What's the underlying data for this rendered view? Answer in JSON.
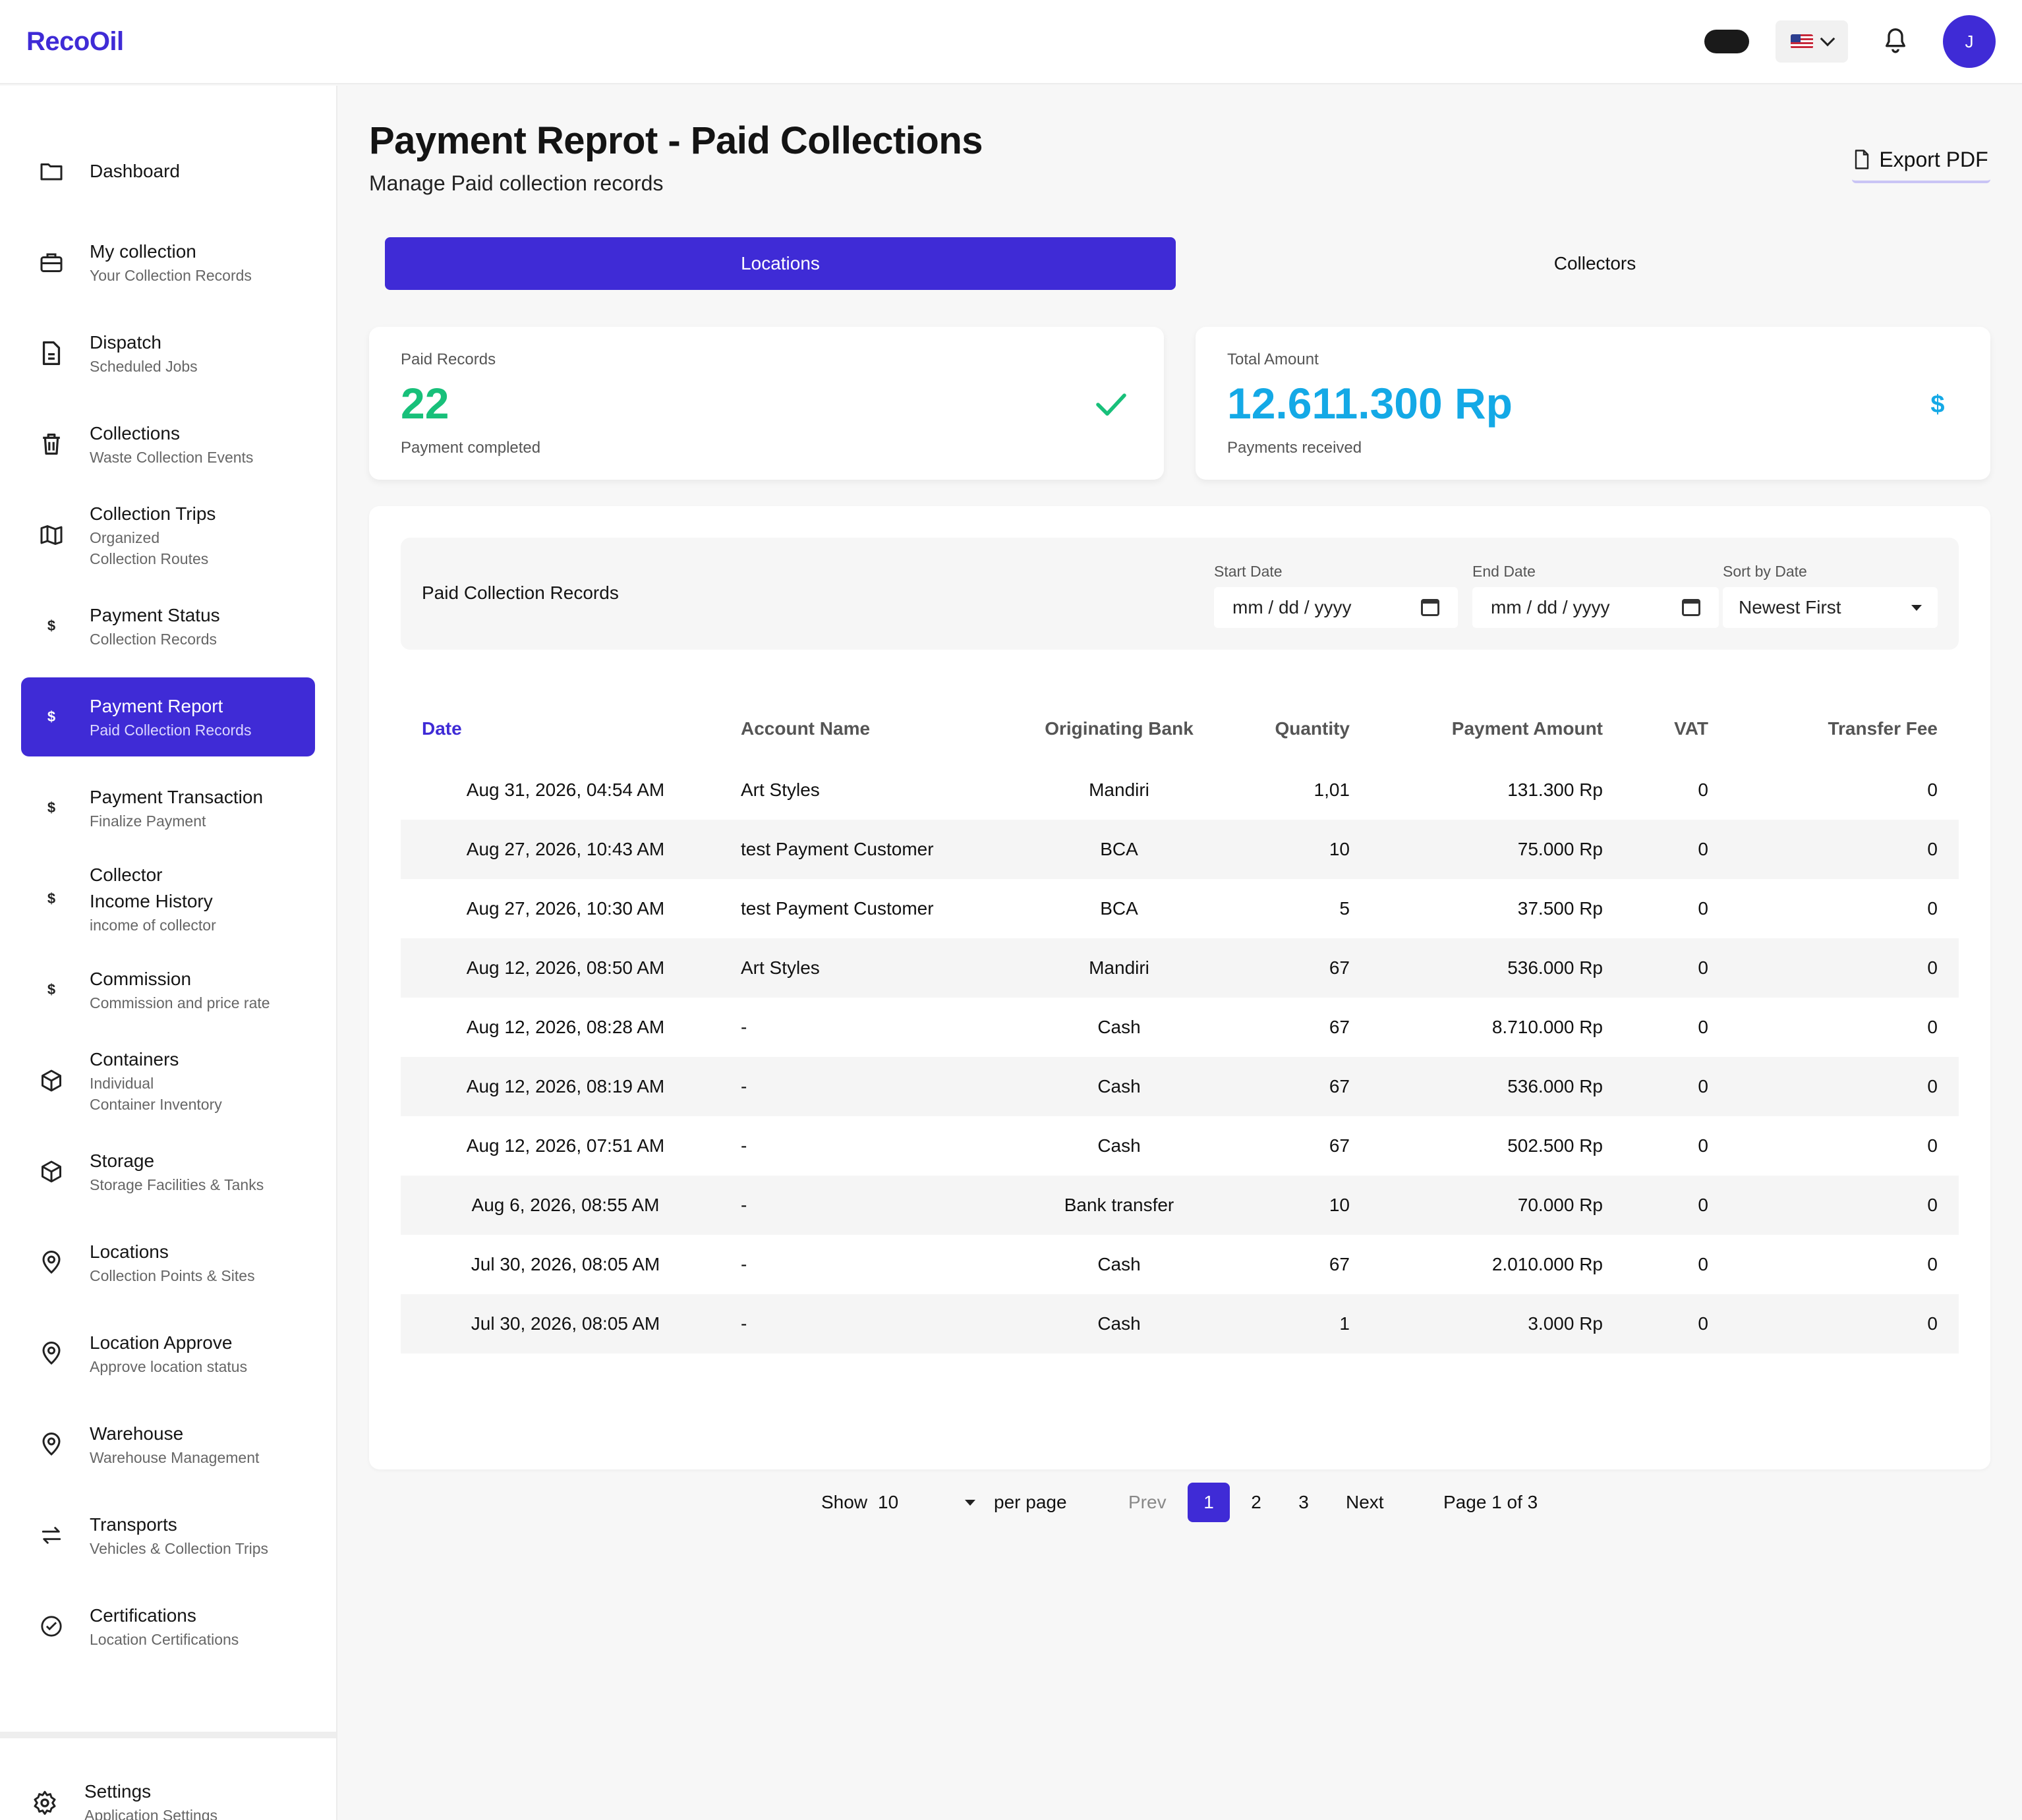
{
  "app": {
    "brand": "RecoOil",
    "avatar_initial": "J"
  },
  "sidebar": {
    "items": [
      {
        "title": "Dashboard",
        "sub": "",
        "icon": "folder-icon"
      },
      {
        "title": "My collection",
        "sub": "Your Collection Records",
        "icon": "briefcase-icon"
      },
      {
        "title": "Dispatch",
        "sub": "Scheduled Jobs",
        "icon": "document-icon"
      },
      {
        "title": "Collections",
        "sub": "Waste Collection Events",
        "icon": "trash-icon"
      },
      {
        "title": "Collection Trips",
        "sub": "Organized\nCollection Routes",
        "icon": "map-icon"
      },
      {
        "title": "Payment Status",
        "sub": "Collection Records",
        "icon": "dollar-icon"
      },
      {
        "title": "Payment Report",
        "sub": "Paid Collection Records",
        "icon": "dollar-icon"
      },
      {
        "title": "Payment Transaction",
        "sub": "Finalize Payment",
        "icon": "dollar-icon"
      },
      {
        "title": "Collector\nIncome History",
        "sub": "income of collector",
        "icon": "dollar-icon"
      },
      {
        "title": "Commission",
        "sub": "Commission and price rate",
        "icon": "dollar-icon"
      },
      {
        "title": "Containers",
        "sub": "Individual\nContainer Inventory",
        "icon": "box-icon"
      },
      {
        "title": "Storage",
        "sub": "Storage Facilities & Tanks",
        "icon": "box-icon"
      },
      {
        "title": "Locations",
        "sub": "Collection Points & Sites",
        "icon": "location-pin-icon"
      },
      {
        "title": "Location Approve",
        "sub": "Approve location status",
        "icon": "location-pin-icon"
      },
      {
        "title": "Warehouse",
        "sub": "Warehouse Management",
        "icon": "location-pin-icon"
      },
      {
        "title": "Transports",
        "sub": "Vehicles & Collection Trips",
        "icon": "swap-arrows-icon"
      },
      {
        "title": "Certifications",
        "sub": "Location Certifications",
        "icon": "check-circle-icon"
      }
    ],
    "settings": {
      "title": "Settings",
      "sub": "Application Settings"
    }
  },
  "header": {
    "title": "Payment Reprot - Paid Collections",
    "subtitle": "Manage Paid collection records",
    "export_label": "Export PDF"
  },
  "tabs": {
    "locations": "Locations",
    "collectors": "Collectors"
  },
  "stats": {
    "paid": {
      "label": "Paid Records",
      "value": "22",
      "foot": "Payment completed",
      "color": "#18c07a"
    },
    "total": {
      "label": "Total Amount",
      "value": "12.611.300 Rp",
      "foot": "Payments received",
      "color": "#14a9e6",
      "icon_glyph": "$"
    }
  },
  "filters": {
    "title": "Paid Collection Records",
    "start_label": "Start Date",
    "start_placeholder": "mm / dd / yyyy",
    "end_label": "End Date",
    "end_placeholder": "mm / dd / yyyy",
    "sort_label": "Sort by Date",
    "sort_value": "Newest First"
  },
  "table": {
    "headers": {
      "date": "Date",
      "account": "Account Name",
      "bank": "Originating Bank",
      "qty": "Quantity",
      "amount": "Payment Amount",
      "vat": "VAT",
      "fee": "Transfer Fee"
    },
    "rows": [
      {
        "date": "Aug 31, 2026, 04:54 AM",
        "account": "Art Styles",
        "bank": "Mandiri",
        "qty": "1,01",
        "amount": "131.300 Rp",
        "vat": "0",
        "fee": "0"
      },
      {
        "date": "Aug 27, 2026, 10:43 AM",
        "account": "test Payment Customer",
        "bank": "BCA",
        "qty": "10",
        "amount": "75.000 Rp",
        "vat": "0",
        "fee": "0"
      },
      {
        "date": "Aug 27, 2026, 10:30 AM",
        "account": "test Payment Customer",
        "bank": "BCA",
        "qty": "5",
        "amount": "37.500 Rp",
        "vat": "0",
        "fee": "0"
      },
      {
        "date": "Aug 12, 2026, 08:50 AM",
        "account": "Art Styles",
        "bank": "Mandiri",
        "qty": "67",
        "amount": "536.000 Rp",
        "vat": "0",
        "fee": "0"
      },
      {
        "date": "Aug 12, 2026, 08:28 AM",
        "account": "-",
        "bank": "Cash",
        "qty": "67",
        "amount": "8.710.000 Rp",
        "vat": "0",
        "fee": "0"
      },
      {
        "date": "Aug 12, 2026, 08:19 AM",
        "account": "-",
        "bank": "Cash",
        "qty": "67",
        "amount": "536.000 Rp",
        "vat": "0",
        "fee": "0"
      },
      {
        "date": "Aug 12, 2026, 07:51 AM",
        "account": "-",
        "bank": "Cash",
        "qty": "67",
        "amount": "502.500 Rp",
        "vat": "0",
        "fee": "0"
      },
      {
        "date": "Aug 6, 2026, 08:55 AM",
        "account": "-",
        "bank": "Bank transfer",
        "qty": "10",
        "amount": "70.000 Rp",
        "vat": "0",
        "fee": "0"
      },
      {
        "date": "Jul 30, 2026, 08:05 AM",
        "account": "-",
        "bank": "Cash",
        "qty": "67",
        "amount": "2.010.000 Rp",
        "vat": "0",
        "fee": "0"
      },
      {
        "date": "Jul 30, 2026, 08:05 AM",
        "account": "-",
        "bank": "Cash",
        "qty": "1",
        "amount": "3.000 Rp",
        "vat": "0",
        "fee": "0"
      }
    ]
  },
  "pagination": {
    "show_label": "Show",
    "per_page_value": "10",
    "per_page_label": "per page",
    "prev": "Prev",
    "pages": [
      "1",
      "2",
      "3"
    ],
    "next": "Next",
    "status": "Page 1 of 3"
  },
  "colors": {
    "accent": "#3f2bd6",
    "success": "#18c07a",
    "info": "#14a9e6"
  }
}
